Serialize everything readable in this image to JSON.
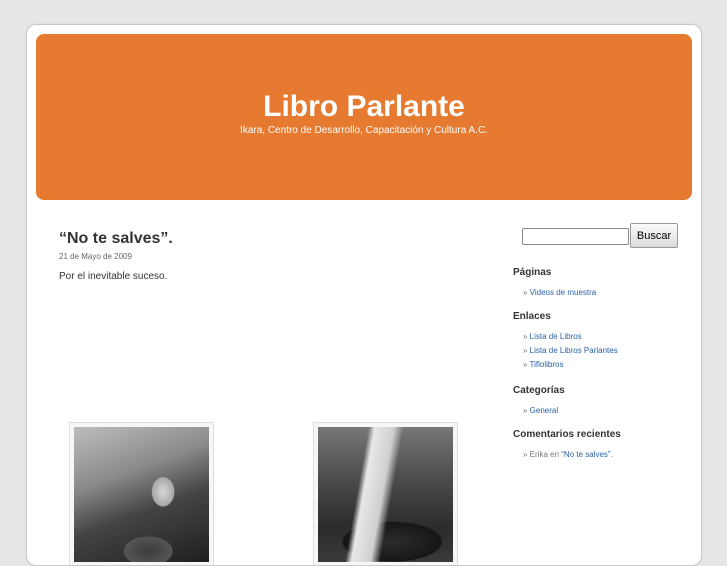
{
  "header": {
    "title": "Libro Parlante",
    "description": "Ikara, Centro de Desarrollo, Capacitación y Cultura A.C."
  },
  "post": {
    "title": "“No te salves”.",
    "date": "21 de Mayo de 2009",
    "body": "Por el inevitable suceso."
  },
  "sidebar": {
    "search": {
      "placeholder": "",
      "value": "",
      "button_label": "Buscar"
    },
    "paginas": {
      "title": "Páginas",
      "items": [
        {
          "prefix": "» ",
          "label": "Videos de muestra"
        }
      ]
    },
    "enlaces": {
      "title": "Enlaces",
      "items": [
        {
          "prefix": "» ",
          "label": "Lista de Libros"
        },
        {
          "prefix": "» ",
          "label": "Lista de Libros Parlantes"
        },
        {
          "prefix": "» ",
          "label": "Tiflolibros"
        }
      ]
    },
    "categorias": {
      "title": "Categorías",
      "items": [
        {
          "prefix": "» ",
          "label": "General"
        }
      ]
    },
    "comentarios": {
      "title": "Comentarios recientes",
      "items": [
        {
          "prefix": "» Erika en ",
          "label": "“No te salves”",
          "suffix": "."
        }
      ]
    }
  },
  "colors": {
    "header_bg": "#e67a30",
    "page_bg": "#e7e7e7",
    "link": "#2a62a6"
  }
}
